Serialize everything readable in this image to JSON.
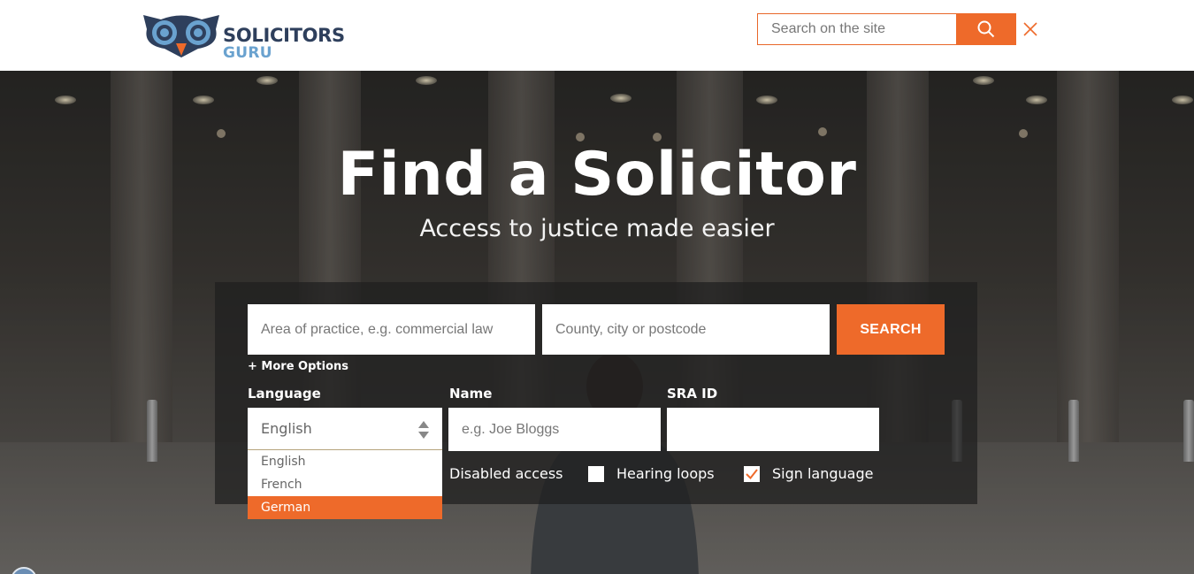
{
  "header": {
    "logo_line1": "SOLICITORS",
    "logo_line2": "GURU",
    "site_search_placeholder": "Search on the site",
    "search_icon": "search-icon",
    "close_icon": "close-icon"
  },
  "hero": {
    "title": "Find a Solicitor",
    "subtitle": "Access to justice made easier"
  },
  "search_form": {
    "practice_placeholder": "Area of practice, e.g. commercial law",
    "location_placeholder": "County, city or postcode",
    "search_label": "SEARCH",
    "more_options": "+ More Options",
    "language_label": "Language",
    "language_value": "English",
    "language_options": [
      "English",
      "French",
      "German"
    ],
    "language_highlighted": "German",
    "name_label": "Name",
    "name_placeholder": "e.g. Joe Bloggs",
    "sra_label": "SRA ID",
    "sra_value": "",
    "accessibility": [
      {
        "label": "Disabled access",
        "checked": null
      },
      {
        "label": "Hearing loops",
        "checked": false
      },
      {
        "label": "Sign language",
        "checked": true
      }
    ]
  },
  "colors": {
    "accent": "#ee6a2a",
    "brand_dark": "#2e3f5c",
    "brand_light": "#6aa2cf"
  }
}
